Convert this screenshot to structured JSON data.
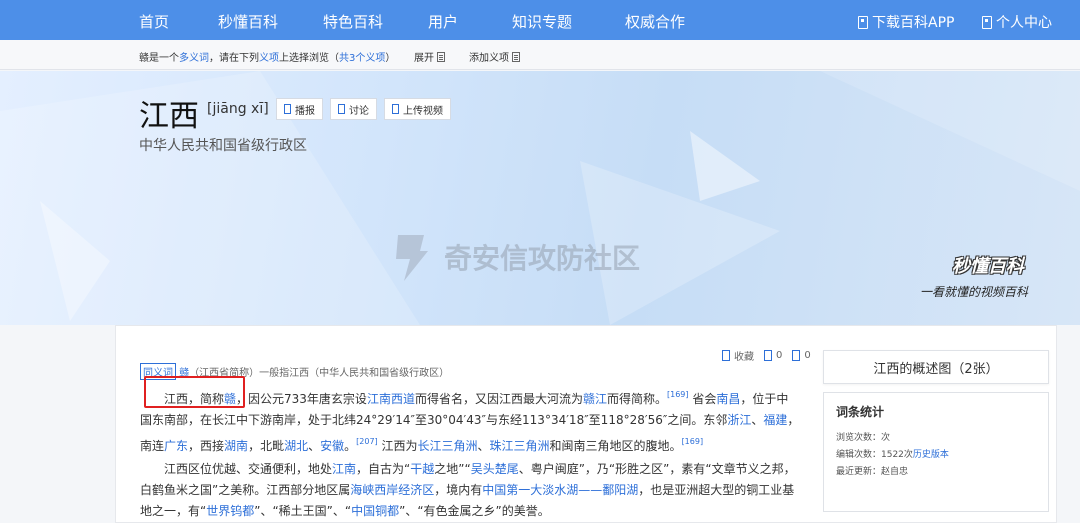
{
  "nav": {
    "items": [
      "首页",
      "秒懂百科",
      "特色百科",
      "用户",
      "知识专题",
      "权威合作"
    ],
    "download_app": "下载百科APP",
    "personal_center": "个人中心"
  },
  "polysemy": {
    "p1": "赣是一个",
    "link_word": "多义词",
    "p2": "，请在下列",
    "link_item": "义项",
    "p3": "上选择浏览（",
    "link_count": "共3个义项",
    "p4": "）",
    "expand": "展开",
    "add_item": "添加义项"
  },
  "header": {
    "title": "江西",
    "pinyin": "[jiāng xī]",
    "buttons": [
      "播报",
      "讨论",
      "上传视频"
    ],
    "subtitle": "中华人民共和国省级行政区"
  },
  "banner": {
    "watermark": "奇安信攻防社区",
    "brand": "秒懂百科",
    "slogan": "一看就懂的视频百科"
  },
  "crumb": {
    "tag": "同义词",
    "link": "赣",
    "rest": "（江西省简称）一般指江西（中华人民共和国省级行政区）"
  },
  "actions": {
    "collect": "收藏",
    "like_count": "0",
    "share_count": "0"
  },
  "para1": {
    "t1": "江西，简称",
    "l1": "赣",
    "t2": "，因公元733年唐玄宗设",
    "l2": "江南西道",
    "t3": "而得省名，又因江西最大河流为",
    "l3": "赣江",
    "t4": "而得简称。",
    "s1": "[169]",
    "t5": "省会",
    "l4": "南昌",
    "t6": "，位于中国东南部，在长江中下游南岸，处于北纬24°29′14″至30°04′43″与东经113°34′18″至118°28′56″之间。东邻",
    "l5": "浙江",
    "t7": "、",
    "l6": "福建",
    "t8": "，南连",
    "l7": "广东",
    "t9": "，西接",
    "l8": "湖南",
    "t10": "，北毗",
    "l9": "湖北",
    "t11": "、",
    "l10": "安徽",
    "t12": "。",
    "s2": "[207]",
    "t13": "江西为",
    "l11": "长江三角洲",
    "t14": "、",
    "l12": "珠江三角洲",
    "t15": "和闽南三角地区的腹地。",
    "s3": "[169]"
  },
  "para2": {
    "t1": "江西区位优越、交通便利，地处",
    "l1": "江南",
    "t2": "，自古为“",
    "l2": "干越",
    "t3": "之地”“",
    "l3": "吴头楚尾",
    "t4": "、粤户闽庭”，乃“形胜之区”，素有“文章节义之邦，白鹤鱼米之国”之美称。江西部分地区属",
    "l4": "海峡西岸经济区",
    "t5": "，境内有",
    "l5": "中国第一大淡水湖——鄱阳湖",
    "t6": "，也是亚洲超大型的铜工业基地之一，有“",
    "l6": "世界钨都",
    "t7": "”、“稀土王国”、“",
    "l7": "中国铜都",
    "t8": "”、“有色金属之乡”的美誉。"
  },
  "side": {
    "overview": "江西的概述图（2张）",
    "stats_title": "词条统计",
    "views": "浏览次数：次",
    "edits_prefix": "编辑次数：1522次",
    "history": "历史版本",
    "last_update": "最近更新：赵自忠"
  },
  "colors": {
    "nav_bg": "#4d8fe8",
    "link": "#2d6fd8",
    "highlight_box": "#e02020"
  }
}
